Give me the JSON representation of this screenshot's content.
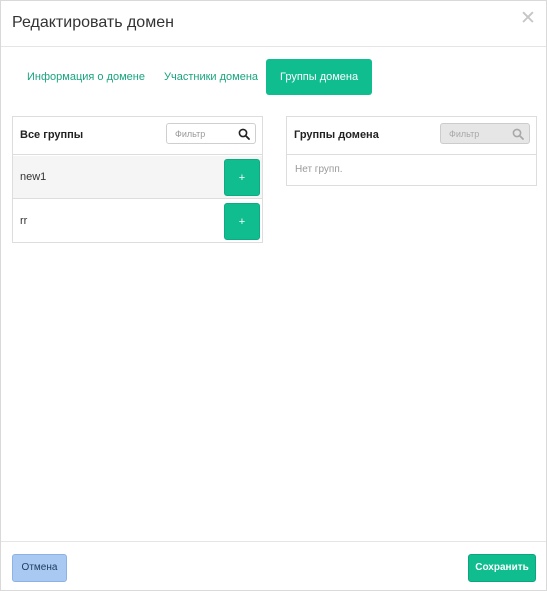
{
  "modal": {
    "title": "Редактировать домен",
    "close_symbol": "✕"
  },
  "tabs": [
    {
      "label": "Информация о домене",
      "active": false
    },
    {
      "label": "Участники домена",
      "active": false
    },
    {
      "label": "Группы домена",
      "active": true
    }
  ],
  "all_groups": {
    "title": "Все группы",
    "filter_placeholder": "Фильтр",
    "items": [
      {
        "name": "new1",
        "add_label": "+"
      },
      {
        "name": "rr",
        "add_label": "+"
      }
    ]
  },
  "domain_groups": {
    "title": "Группы домена",
    "filter_placeholder": "Фильтр",
    "empty_text": "Нет групп."
  },
  "footer": {
    "cancel_label": "Отмена",
    "save_label": "Сохранить"
  },
  "colors": {
    "accent": "#0fbd8f",
    "cancel_bg": "#a9c9f2"
  },
  "icons": {
    "close": "close-icon",
    "search": "search-icon"
  }
}
